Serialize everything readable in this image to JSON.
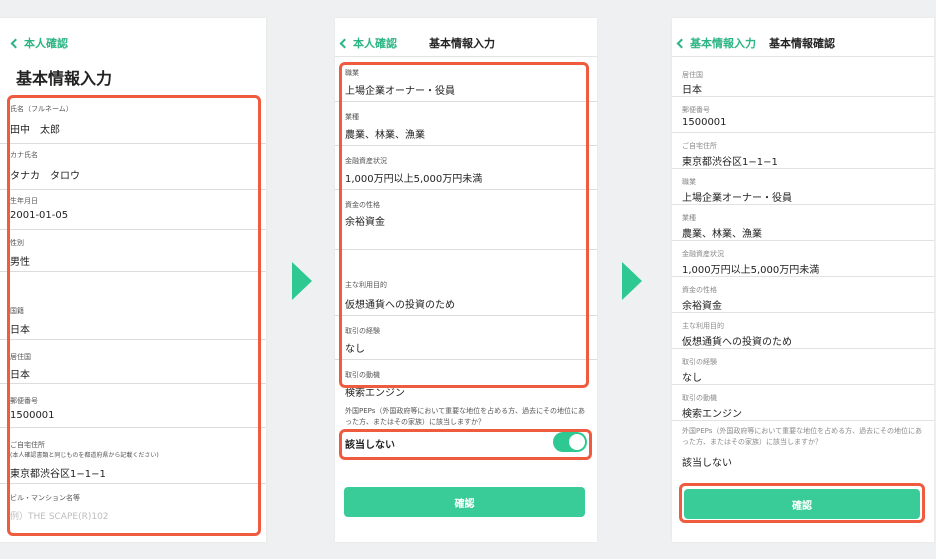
{
  "colors": {
    "accent": "#2ec993",
    "highlight": "#ef5b3e",
    "button": "#39cc98"
  },
  "screen1": {
    "back_label": "本人確認",
    "page_title": "基本情報入力",
    "fields": [
      {
        "label": "氏名（フルネーム）",
        "value": "田中　太郎"
      },
      {
        "label": "カナ氏名",
        "value": "タナカ　タロウ"
      },
      {
        "label": "生年月日",
        "value": "2001-01-05"
      },
      {
        "label": "性別",
        "value": "男性"
      },
      {
        "label": "国籍",
        "value": "日本"
      },
      {
        "label": "居住国",
        "value": "日本"
      },
      {
        "label": "郵便番号",
        "value": "1500001"
      },
      {
        "label": "ご自宅住所",
        "sublabel": "(本人確認書類と同じものを都道府県から記載ください)",
        "value": "東京都渋谷区1−1−1"
      },
      {
        "label": "ビル・マンション名等",
        "placeholder": "例）THE SCAPE(R)102"
      }
    ]
  },
  "screen2": {
    "back_label": "本人確認",
    "header_title": "基本情報入力",
    "fields": [
      {
        "label": "職業",
        "value": "上場企業オーナー・役員"
      },
      {
        "label": "業種",
        "value": "農業、林業、漁業"
      },
      {
        "label": "金融資産状況",
        "value": "1,000万円以上5,000万円未満"
      },
      {
        "label": "資金の性格",
        "value": "余裕資金"
      },
      {
        "label": "主な利用目的",
        "value": "仮想通貨への投資のため"
      },
      {
        "label": "取引の経験",
        "value": "なし"
      },
      {
        "label": "取引の動機",
        "value": "検索エンジン"
      }
    ],
    "peps_note": "外国PEPs（外国政府等において重要な地位を占める方、過去にその地位にあった方、またはその家族）に該当しますか？",
    "toggle_label": "該当しない",
    "toggle_on": true,
    "confirm_label": "確認"
  },
  "screen3": {
    "back_label": "基本情報入力",
    "header_title": "基本情報確認",
    "rows": [
      {
        "label": "居住国",
        "value": "日本"
      },
      {
        "label": "郵便番号",
        "value": "1500001"
      },
      {
        "label": "ご自宅住所",
        "value": "東京都渋谷区1−1−1"
      },
      {
        "label": "職業",
        "value": "上場企業オーナー・役員"
      },
      {
        "label": "業種",
        "value": "農業、林業、漁業"
      },
      {
        "label": "金融資産状況",
        "value": "1,000万円以上5,000万円未満"
      },
      {
        "label": "資金の性格",
        "value": "余裕資金"
      },
      {
        "label": "主な利用目的",
        "value": "仮想通貨への投資のため"
      },
      {
        "label": "取引の経験",
        "value": "なし"
      },
      {
        "label": "取引の動機",
        "value": "検索エンジン"
      }
    ],
    "peps_note": "外国PEPs（外国政府等において重要な地位を占める方、過去にその地位にあった方、またはその家族）に該当しますか？",
    "peps_value": "該当しない",
    "confirm_label": "確認"
  }
}
